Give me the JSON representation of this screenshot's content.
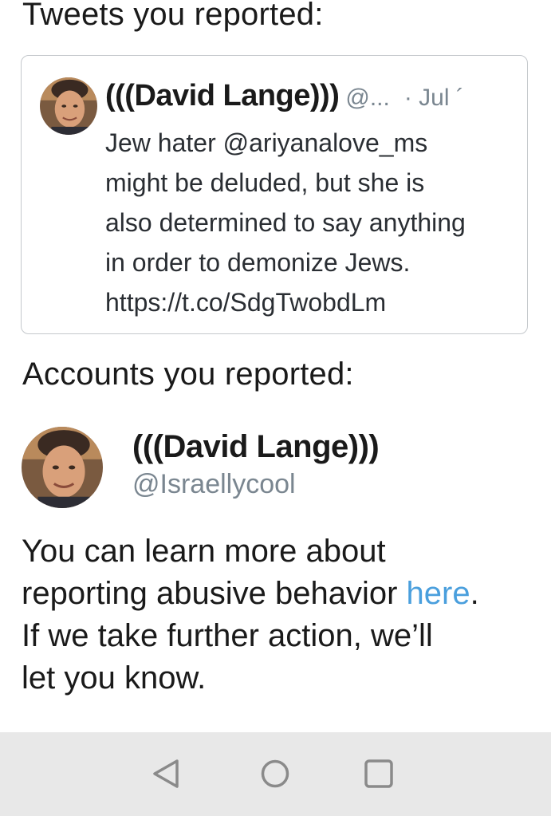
{
  "sections": {
    "tweets_heading": "Tweets you reported:",
    "accounts_heading": "Accounts you reported:"
  },
  "tweet": {
    "author_name": "(((David Lange)))",
    "author_handle_truncated": "@...",
    "date": "· Jul ´",
    "body_lines": [
      "Jew hater @ariyanalove_ms",
      "might be deluded, but she is",
      "also determined to say anything",
      "in order to demonize Jews.",
      "https://t.co/SdgTwobdLm"
    ]
  },
  "account": {
    "name": "(((David Lange)))",
    "handle": "@Israellycool"
  },
  "info": {
    "line1": "You can learn more about",
    "line2_prefix": "reporting abusive behavior ",
    "line2_link": "here",
    "line2_suffix": ".",
    "line3": "If we take further action, we’ll",
    "line4": "let you know."
  },
  "navigation": {
    "back_icon": "back-triangle-icon",
    "home_icon": "home-circle-icon",
    "recents_icon": "recents-square-icon"
  },
  "colors": {
    "link": "#4a9fdd",
    "secondary_text": "#7a8690",
    "card_border": "#c4c8cc",
    "nav_background": "#e8e8e8"
  }
}
